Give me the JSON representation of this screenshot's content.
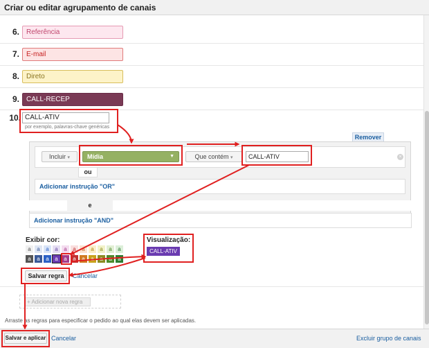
{
  "window": {
    "title": "Criar ou editar agrupamento de canais"
  },
  "channels": [
    {
      "number": "6.",
      "name": "Referência",
      "bg": "#fde7ef",
      "border": "#e59ab3",
      "color": "#c0466d"
    },
    {
      "number": "7.",
      "name": "E-mail",
      "bg": "#fde4e4",
      "border": "#e07a7a",
      "color": "#c62020"
    },
    {
      "number": "8.",
      "name": "Direto",
      "bg": "#fdf3c8",
      "border": "#d8be5c",
      "color": "#8a7420"
    },
    {
      "number": "9.",
      "name": "CALL-RECEP",
      "bg": "#7a3a55",
      "border": "#6a2d47",
      "color": "#ffffff"
    }
  ],
  "editing": {
    "number": "10.",
    "name_value": "CALL-ATIV",
    "hint": "por exemplo, palavras-chave genéricas",
    "remove_label": "Remover"
  },
  "condition": {
    "include_label": "Incluir",
    "dimension_label": "Mídia",
    "match_label": "Que contém",
    "value": "CALL-ATIV",
    "remove_icon": "close-circle-icon",
    "or_tab": "ou",
    "add_or": "Adicionar instrução \"OR\"",
    "and_label": "e",
    "add_and": "Adicionar instrução \"AND\""
  },
  "color": {
    "label": "Exibir cor:",
    "preview_label": "Visualização:",
    "preview_text": "CALL-ATIV",
    "preview_bg": "#6a3bb0",
    "swatch_letter": "a",
    "light": [
      {
        "bg": "#f0f0f0",
        "fg": "#555555"
      },
      {
        "bg": "#dfe6f3",
        "fg": "#3a5a99"
      },
      {
        "bg": "#d9e4f7",
        "fg": "#2c62c6"
      },
      {
        "bg": "#e4ddf2",
        "fg": "#6a4aa3"
      },
      {
        "bg": "#f4dcef",
        "fg": "#a43a8a"
      },
      {
        "bg": "#f9dede",
        "fg": "#c03030"
      },
      {
        "bg": "#fbe3d1",
        "fg": "#c46a20"
      },
      {
        "bg": "#fbefc9",
        "fg": "#a98718"
      },
      {
        "bg": "#f2f2c8",
        "fg": "#8c8c22"
      },
      {
        "bg": "#e1efd4",
        "fg": "#4f8a2b"
      },
      {
        "bg": "#dcefd9",
        "fg": "#2e7d32"
      }
    ],
    "dark": [
      {
        "bg": "#555555",
        "fg": "#ffffff"
      },
      {
        "bg": "#3a5a99",
        "fg": "#ffffff"
      },
      {
        "bg": "#2c62c6",
        "fg": "#ffffff"
      },
      {
        "bg": "#6a3bb0",
        "fg": "#ffffff"
      },
      {
        "bg": "#a43a8a",
        "fg": "#ffffff"
      },
      {
        "bg": "#c03030",
        "fg": "#ffffff"
      },
      {
        "bg": "#d07a20",
        "fg": "#ffffff"
      },
      {
        "bg": "#c9a21c",
        "fg": "#ffffff"
      },
      {
        "bg": "#8c8c22",
        "fg": "#ffffff"
      },
      {
        "bg": "#4f8a2b",
        "fg": "#ffffff"
      },
      {
        "bg": "#2e7d32",
        "fg": "#ffffff"
      }
    ],
    "selected_dark_index": 3
  },
  "rule_actions": {
    "save": "Salvar regra",
    "cancel": "Cancelar"
  },
  "add_rule": "Adicionar nova regra",
  "drag_text": "Arraste as regras para especificar o pedido ao qual elas devem ser aplicadas.",
  "footer": {
    "save_apply": "Salvar e aplicar",
    "cancel": "Cancelar",
    "delete_group": "Excluir grupo de canais"
  },
  "annotation_color": "#e02020"
}
